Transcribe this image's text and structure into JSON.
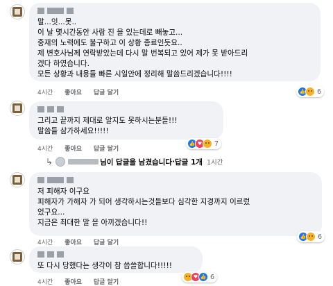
{
  "comments": [
    {
      "text": "말...잇...못..\n이 날 몇시간동안 사람 진 을 있는데로 빼놓고...\n중재의 노력에도 불구하고 이 상황 종료인듯요..\n제 변호사님께 연락받았는데 다시 말 번복되고 있어 제가 못 받아드리\n겠다 하였습니다.\n모든 상황과 내용들 빠른 시일안에 정리해 말씀드리겠습니다!!!!",
      "time": "4시간",
      "like_label": "좋아요",
      "reply_label": "답글 달기",
      "reaction_count": "6",
      "reactions": [
        "like-icon",
        "sad-icon"
      ]
    },
    {
      "text": "그리고 끝까지 제대로 알지도 못하시는분들!!!\n말씀들 삼가하세요!!!!!",
      "time": "4시간",
      "like_label": "좋아요",
      "reply_label": "답글 달기",
      "reaction_count": "7",
      "reactions": [
        "like-icon",
        "love-icon",
        "sad-icon"
      ]
    },
    {
      "text": "저 피해자 이구요\n피해자가 가해자 가 되어 생각하시는것들보다 심각한 지경까지 이르렀\n었구요...\n지금은 최대한 말 을 아끼겠습니다!!",
      "time": "4시간",
      "like_label": "좋아요",
      "reply_label": "답글 달기",
      "reaction_count": "6",
      "reactions": [
        "like-icon",
        "sad-icon"
      ]
    },
    {
      "text": "또 다시 당했다는 생각이 참 씁쓸합니다!!!!!",
      "time": "4시간",
      "like_label": "좋아요",
      "reply_label": "답글 달기",
      "reaction_count": "6",
      "reactions": [
        "sad-icon",
        "love-icon",
        "like-icon"
      ]
    }
  ],
  "reply_summary": {
    "text_suffix": "님이 답글을 남겼습니다",
    "separator": " · ",
    "count": "답글 1개",
    "time": "1시간"
  },
  "colors": {
    "bubble": "#f0f2f5",
    "meta_text": "#65676b",
    "like": "#1877f2",
    "love": "#f33e58",
    "sad": "#f7b125"
  }
}
